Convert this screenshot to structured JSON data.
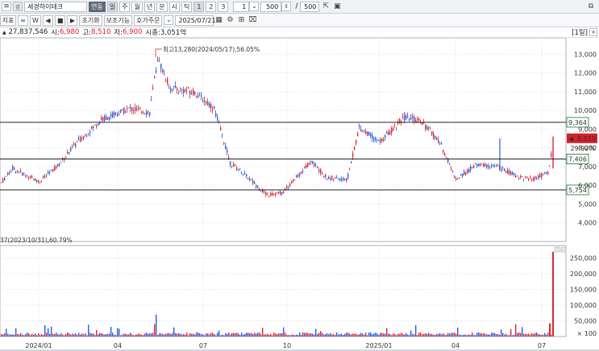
{
  "toolbar": {
    "stock_code_label": "",
    "stock_name": "세경하이테크",
    "link_button": "연동",
    "periods": [
      "일",
      "주",
      "월",
      "년",
      "분",
      "시",
      "틱"
    ],
    "num_buttons": [
      "1",
      "2",
      "3"
    ],
    "interval_value": "1",
    "count_value": "500",
    "count_total": "500",
    "separator": "/"
  },
  "toolbar2": {
    "indicator_label": "지표",
    "init_label": "초기화",
    "aux_label": "보조기능",
    "order_label": "호가주문",
    "date_value": "2025/07/21"
  },
  "info": {
    "volume": "27,837,546",
    "open_label": "시:",
    "open": "6,980",
    "high_label": "고:",
    "high": "8,510",
    "low_label": "저:",
    "low": "6,900",
    "mcap_label": "시총:",
    "mcap": "3,051억",
    "period_badge": "[1일]"
  },
  "chart_data": {
    "type": "candlestick",
    "price_axis": [
      4000,
      5000,
      6000,
      7000,
      8000,
      9000,
      10000,
      11000,
      12000,
      13000
    ],
    "price_tick_labels": [
      "4,000",
      "5,000",
      "6,000",
      "7,000",
      "8,000",
      "9,000",
      "10,000",
      "11,000",
      "12,000",
      "13,000"
    ],
    "volume_axis_labels": [
      "250,000",
      "200,000",
      "150,000",
      "100,000",
      "50,000",
      "× 100"
    ],
    "x_tick_labels": [
      "2024/01",
      "04",
      "07",
      "10",
      "2025/01",
      "04",
      "07"
    ],
    "hlines": [
      9364,
      7406,
      5754
    ],
    "hline_labels": [
      "9,364",
      "7,406",
      "5,754"
    ],
    "current_price": "8,510",
    "current_change": "29.92%",
    "max_annotation": "최고13,280(2024/05/17),56.05%",
    "min_annotation": "37(2023/10/31),60.79%",
    "colors": {
      "up": "#e0262e",
      "down": "#2a5bd7",
      "hline": "#000000",
      "grid": "#c8ccd4"
    }
  }
}
